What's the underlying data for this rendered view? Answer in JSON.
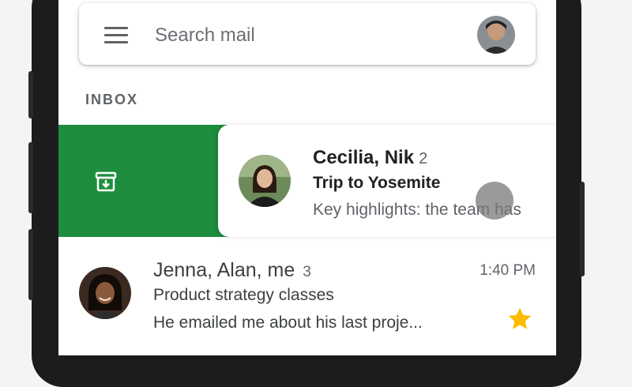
{
  "colors": {
    "archive_green": "#1e8e3e",
    "star_yellow": "#fbbc04",
    "text_primary": "#202124",
    "text_secondary": "#5f6368"
  },
  "search": {
    "placeholder": "Search mail",
    "menu_icon": "hamburger-menu-icon",
    "account_icon": "account-avatar"
  },
  "inbox_label": "INBOX",
  "swipe_action": {
    "icon": "archive-icon"
  },
  "emails": [
    {
      "sender": "Cecilia, Nik",
      "count": "2",
      "subject": "Trip to Yosemite",
      "snippet": "Key highlights: the team has",
      "unread": true
    },
    {
      "sender": "Jenna, Alan, me",
      "count": "3",
      "time": "1:40 PM",
      "subject": "Product strategy classes",
      "snippet": "He emailed me about his last proje...",
      "starred": true
    }
  ]
}
